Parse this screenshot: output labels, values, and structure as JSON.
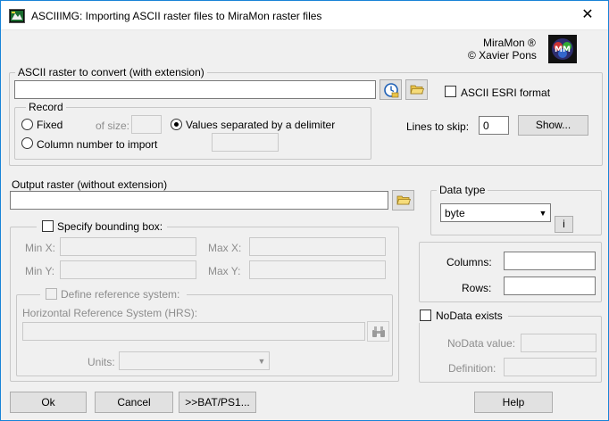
{
  "window": {
    "title": "ASCIIIMG: Importing ASCII raster files to MiraMon raster files",
    "close_glyph": "✕"
  },
  "brand": {
    "line1": "MiraMon ®",
    "line2": "© Xavier Pons"
  },
  "input_section": {
    "title": "ASCII raster to convert (with extension)",
    "value": "",
    "esri_label": "ASCII ESRI format",
    "esri_checked": false
  },
  "record": {
    "title": "Record",
    "fixed_label": "Fixed",
    "of_size_label": "of size:",
    "delimiter_label": "Values separated by a delimiter",
    "column_label": "Column number to import",
    "selected": "delimiter"
  },
  "lines_to_skip": {
    "label": "Lines to skip:",
    "value": "0",
    "show_button": "Show..."
  },
  "output": {
    "label": "Output raster (without extension)",
    "value": ""
  },
  "bbox": {
    "label": "Specify bounding box:",
    "checked": false,
    "min_x": "Min X:",
    "max_x": "Max X:",
    "min_y": "Min Y:",
    "max_y": "Max Y:"
  },
  "refsys": {
    "label": "Define reference system:",
    "checked": false,
    "hrs_label": "Horizontal Reference System (HRS):",
    "units_label": "Units:"
  },
  "data_type": {
    "title": "Data type",
    "selected": "byte",
    "info_button": "i"
  },
  "dims": {
    "columns_label": "Columns:",
    "rows_label": "Rows:",
    "columns_value": "",
    "rows_value": ""
  },
  "nodata": {
    "label": "NoData exists",
    "checked": false,
    "value_label": "NoData value:",
    "definition_label": "Definition:"
  },
  "buttons": {
    "ok": "Ok",
    "cancel": "Cancel",
    "bat": ">>BAT/PS1...",
    "help": "Help"
  },
  "icons": {
    "app": "miramon-app-icon",
    "logo": "miramon-logo-icon",
    "clock": "clock-browse-icon",
    "folder": "folder-open-icon",
    "binoculars": "binoculars-icon",
    "close": "close-icon"
  }
}
